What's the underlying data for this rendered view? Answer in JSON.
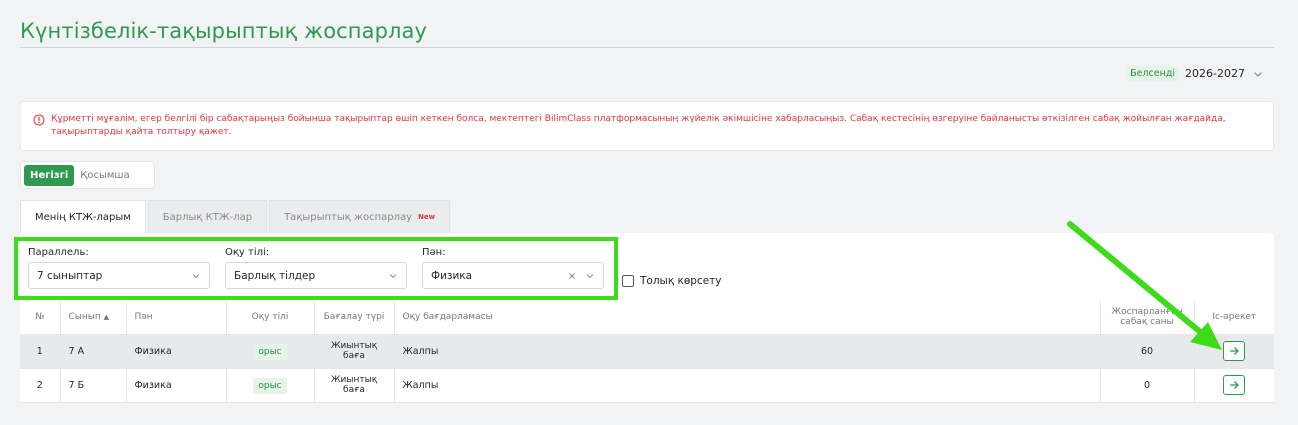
{
  "page": {
    "title": "Күнтізбелік-тақырыптық жоспарлау"
  },
  "year": {
    "badge": "Белсенді",
    "value": "2026-2027",
    "icon": "chevron-down-icon"
  },
  "alert": {
    "icon": "info-circle-icon",
    "text": "Құрметті мұғалім, егер белгілі бір сабақтарыңыз бойынша тақырыптар өшіп кеткен болса, мектептегі BilimClass платформасының жүйелік әкімшісіне хабарласыңыз. Сабақ кестесінің өзгеруіне байланысты өткізілген сабақ жойылған жағдайда, тақырыптарды қайта толтыру қажет.",
    "color": "#e2373e"
  },
  "segment": {
    "primary": "Негізгі",
    "secondary": "Қосымша"
  },
  "tabs": {
    "mine": "Менің КТЖ-ларым",
    "all": "Барлық КТЖ-лар",
    "thematic": "Тақырыптық жоспарлау",
    "new_badge": "New"
  },
  "filters": {
    "parallel": {
      "label": "Параллель:",
      "value": "7 сыныптар"
    },
    "language": {
      "label": "Оқу тілі:",
      "value": "Барлық тілдер"
    },
    "subject": {
      "label": "Пән:",
      "value": "Физика"
    }
  },
  "full_show": {
    "label": "Толық көрсету"
  },
  "table": {
    "headers": {
      "num": "№",
      "class": "Сынып",
      "subject": "Пән",
      "language": "Оқу тілі",
      "assessment_1": "Бағалау түрі",
      "program": "Оқу бағдарламасы",
      "planned_1": "Жоспарланған",
      "planned_2": "сабақ саны",
      "action": "Іс-әрекет"
    },
    "rows": [
      {
        "num": "1",
        "class": "7 А",
        "subject": "Физика",
        "language": "орыс",
        "assessment_1": "Жиынтық",
        "assessment_2": "баға",
        "program": "Жалпы",
        "planned": "60"
      },
      {
        "num": "2",
        "class": "7 Б",
        "subject": "Физика",
        "language": "орыс",
        "assessment_1": "Жиынтық",
        "assessment_2": "баға",
        "program": "Жалпы",
        "planned": "0"
      }
    ]
  },
  "colors": {
    "accent": "#2f9a4f",
    "highlight": "#3fdb1b",
    "error": "#e2373e"
  }
}
